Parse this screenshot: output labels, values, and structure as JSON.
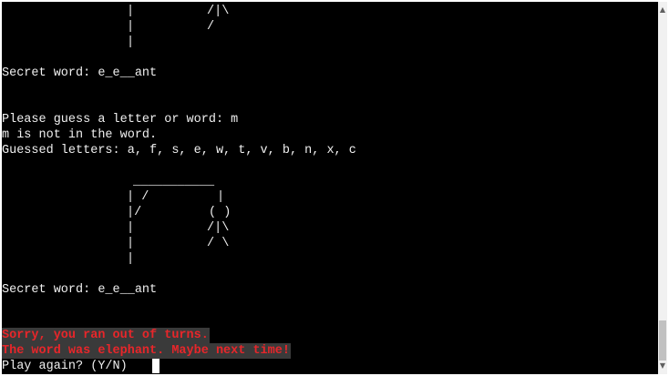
{
  "terminal": {
    "background": "#000000",
    "foreground": "#f0f0f0",
    "error_color": "#e8262a",
    "error_bg": "#3a3a3a",
    "cursor_color": "#ffffff",
    "top_gallows": {
      "row1_post": "|",
      "row1_body": "/|\\",
      "row2_post": "|",
      "row2_body": "/",
      "row3_post": "|"
    },
    "secret_word_1": "Secret word: e_e__ant",
    "prompt": "Please guess a letter or word: m",
    "not_in_word": "m is not in the word.",
    "guessed_letters": "Guessed letters: a, f, s, e, w, t, v, b, n, x, c",
    "bottom_gallows": {
      "beam": "___________",
      "row1_post": "| /",
      "row1_rope": "|",
      "row2_post": "|/",
      "row2_head": "( )",
      "row3_post": "|",
      "row3_body": "/|\\",
      "row4_post": "|",
      "row4_legs": "/ \\",
      "row5_post": "|"
    },
    "secret_word_2": "Secret word: e_e__ant",
    "error_1": "Sorry, you ran out of turns.",
    "error_2": "The word was elephant. Maybe next time!",
    "play_again": "Play again? (Y/N)"
  },
  "scrollbar": {
    "up_icon": "triangle-up",
    "down_icon": "triangle-down",
    "position_fraction": 1.0
  }
}
